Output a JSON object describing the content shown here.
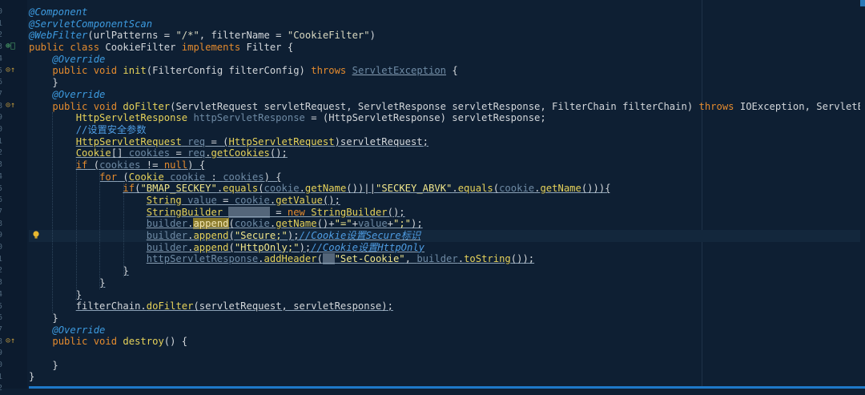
{
  "gutter": {
    "numbers": [
      "0",
      "1",
      "2",
      "3",
      "4",
      "5",
      "6",
      "7",
      "8",
      "9",
      "0",
      "1",
      "2",
      "3",
      "4",
      "5",
      "6",
      "7",
      "8",
      "9",
      "0",
      "1",
      "2",
      "3",
      "4",
      "5",
      "6",
      "7",
      "8",
      "9",
      "0",
      "1",
      "2"
    ],
    "marks": [
      {
        "row": 3,
        "icon": "class-marker-icon",
        "glyph": "⊕ͦ",
        "color": "green"
      },
      {
        "row": 5,
        "icon": "override-method-icon",
        "glyph": "⊙↑"
      },
      {
        "row": 8,
        "icon": "override-method-icon",
        "glyph": "⊙↑"
      },
      {
        "row": 28,
        "icon": "override-method-icon",
        "glyph": "⊙↑"
      }
    ]
  },
  "lines": [
    [
      [
        "ann",
        "@Component"
      ]
    ],
    [
      [
        "ann",
        "@ServletComponentScan"
      ]
    ],
    [
      [
        "ann",
        "@WebFilter"
      ],
      [
        "plain",
        "(urlPatterns = "
      ],
      [
        "str",
        "\"/*\""
      ],
      [
        "plain",
        ", filterName = "
      ],
      [
        "str",
        "\"CookieFilter\""
      ],
      [
        "plain",
        ")"
      ]
    ],
    [
      [
        "kw",
        "public class "
      ],
      [
        "plain",
        "CookieFilter "
      ],
      [
        "kw",
        "implements "
      ],
      [
        "plain",
        "Filter {"
      ]
    ],
    [
      [
        "plain",
        "    "
      ],
      [
        "ann",
        "@Override"
      ]
    ],
    [
      [
        "plain",
        "    "
      ],
      [
        "kw",
        "public void "
      ],
      [
        "method",
        "init"
      ],
      [
        "plain",
        "(FilterConfig filterConfig) "
      ],
      [
        "kw",
        "throws "
      ],
      [
        "muted ul",
        "ServletException"
      ],
      [
        "plain",
        " {"
      ]
    ],
    [
      [
        "plain",
        "    }"
      ]
    ],
    [
      [
        "plain",
        "    "
      ],
      [
        "ann",
        "@Override"
      ]
    ],
    [
      [
        "plain",
        "    "
      ],
      [
        "kw",
        "public void "
      ],
      [
        "method",
        "doFilter"
      ],
      [
        "plain",
        "(ServletRequest servletRequest, ServletResponse servletResponse, FilterChain filterChain) "
      ],
      [
        "kw",
        "throws "
      ],
      [
        "plain",
        "IOException, ServletExceptio"
      ]
    ],
    [
      [
        "plain",
        "        "
      ],
      [
        "cls",
        "HttpServletResponse "
      ],
      [
        "muted",
        "httpServletResponse"
      ],
      [
        "plain",
        " = (HttpServletResponse) servletResponse;"
      ]
    ],
    [
      [
        "plain",
        "        "
      ],
      [
        "cmtz",
        "//设置安全参数"
      ]
    ],
    [
      [
        "plain",
        "        "
      ],
      [
        "cls ul",
        "HttpServletRequest"
      ],
      [
        "plain ul",
        " "
      ],
      [
        "muted ul",
        "req"
      ],
      [
        "plain ul",
        " = ("
      ],
      [
        "cls ul",
        "HttpServletRequest"
      ],
      [
        "plain ul",
        ")servletRequest;"
      ]
    ],
    [
      [
        "plain",
        "        "
      ],
      [
        "cls ul",
        "Cookie"
      ],
      [
        "plain ul",
        "[] "
      ],
      [
        "muted ul",
        "cookies"
      ],
      [
        "plain ul",
        " = "
      ],
      [
        "muted ul",
        "req"
      ],
      [
        "plain ul",
        "."
      ],
      [
        "method ul",
        "getCookies"
      ],
      [
        "plain ul",
        "();"
      ]
    ],
    [
      [
        "plain",
        "        "
      ],
      [
        "kw ul",
        "if"
      ],
      [
        "plain ul",
        " ("
      ],
      [
        "muted ul",
        "cookies"
      ],
      [
        "plain ul",
        " != "
      ],
      [
        "kw ul",
        "null"
      ],
      [
        "plain ul",
        ") {"
      ]
    ],
    [
      [
        "plain",
        "            "
      ],
      [
        "kw ul",
        "for"
      ],
      [
        "plain ul",
        " ("
      ],
      [
        "cls ul",
        "Cookie"
      ],
      [
        "plain ul",
        " "
      ],
      [
        "muted ul",
        "cookie"
      ],
      [
        "plain ul",
        " : "
      ],
      [
        "muted ul",
        "cookies"
      ],
      [
        "plain ul",
        ") {"
      ]
    ],
    [
      [
        "plain",
        "                "
      ],
      [
        "kw ul",
        "if"
      ],
      [
        "plain ul",
        "("
      ],
      [
        "str2 ul",
        "\"BMAP_SECKEY\""
      ],
      [
        "plain ul",
        "."
      ],
      [
        "method ul",
        "equals"
      ],
      [
        "plain ul",
        "("
      ],
      [
        "muted ul",
        "cookie"
      ],
      [
        "plain ul",
        "."
      ],
      [
        "method ul",
        "getName"
      ],
      [
        "plain ul",
        "())||"
      ],
      [
        "str2 ul",
        "\"SECKEY_ABVK\""
      ],
      [
        "plain ul",
        "."
      ],
      [
        "method ul",
        "equals"
      ],
      [
        "plain ul",
        "("
      ],
      [
        "muted ul",
        "cookie"
      ],
      [
        "plain ul",
        "."
      ],
      [
        "method ul",
        "getName"
      ],
      [
        "plain ul",
        "())){"
      ]
    ],
    [
      [
        "plain",
        "                    "
      ],
      [
        "cls ul",
        "String"
      ],
      [
        "plain ul",
        " "
      ],
      [
        "muted ul",
        "value"
      ],
      [
        "plain ul",
        " = "
      ],
      [
        "muted ul",
        "cookie"
      ],
      [
        "plain ul",
        "."
      ],
      [
        "method ul",
        "getValue"
      ],
      [
        "plain ul",
        "();"
      ]
    ],
    [
      [
        "plain",
        "                    "
      ],
      [
        "cls ul",
        "StringBuilder"
      ],
      [
        "plain ul",
        " "
      ],
      [
        "hlbox ul",
        "builder"
      ],
      [
        "plain ul",
        " = "
      ],
      [
        "kw ul",
        "new "
      ],
      [
        "cls ul",
        "StringBuilder"
      ],
      [
        "plain ul",
        "();"
      ]
    ],
    [
      [
        "plain",
        "                    "
      ],
      [
        "muted ul",
        "builder"
      ],
      [
        "plain ul",
        "."
      ],
      [
        "hl ul",
        "append"
      ],
      [
        "plain ul",
        "("
      ],
      [
        "muted ul",
        "cookie"
      ],
      [
        "plain ul",
        "."
      ],
      [
        "method ul",
        "getName"
      ],
      [
        "plain ul",
        "()+"
      ],
      [
        "str2 ul",
        "\"=\""
      ],
      [
        "plain ul",
        "+"
      ],
      [
        "muted ul",
        "value"
      ],
      [
        "plain ul",
        "+"
      ],
      [
        "str2 ul",
        "\";\""
      ],
      [
        "plain ul",
        ");"
      ]
    ],
    [
      [
        "plain",
        "                    "
      ],
      [
        "muted ul",
        "builder"
      ],
      [
        "plain ul",
        "."
      ],
      [
        "method ul",
        "append"
      ],
      [
        "plain ul",
        "("
      ],
      [
        "str2 ul",
        "\"Secure;\""
      ],
      [
        "plain ul",
        ");"
      ],
      [
        "cmt ul",
        "//Cookie设置Secure标识"
      ]
    ],
    [
      [
        "plain",
        "                    "
      ],
      [
        "muted ul",
        "builder"
      ],
      [
        "plain ul",
        "."
      ],
      [
        "method ul",
        "append"
      ],
      [
        "plain ul",
        "("
      ],
      [
        "str2 ul",
        "\"HttpOnly;\""
      ],
      [
        "plain ul",
        ");"
      ],
      [
        "cmt ul",
        "//Cookie设置HttpOnly"
      ]
    ],
    [
      [
        "plain",
        "                    "
      ],
      [
        "muted ul",
        "httpServletResponse"
      ],
      [
        "plain ul",
        "."
      ],
      [
        "method ul",
        "addHeader"
      ],
      [
        "plain ul",
        "("
      ],
      [
        "hlbox ul",
        "na"
      ],
      [
        "str2 ul",
        "\"Set-Cookie\""
      ],
      [
        "plain ul",
        ", "
      ],
      [
        "muted ul",
        "builder"
      ],
      [
        "plain ul",
        "."
      ],
      [
        "method ul",
        "toString"
      ],
      [
        "plain ul",
        "());"
      ]
    ],
    [
      [
        "plain",
        "                "
      ],
      [
        "plain ul",
        "}"
      ]
    ],
    [
      [
        "plain",
        "            "
      ],
      [
        "plain ul",
        "}"
      ]
    ],
    [
      [
        "plain",
        "        "
      ],
      [
        "plain ul",
        "}"
      ]
    ],
    [
      [
        "plain",
        "        "
      ],
      [
        "plain ul",
        "filterChain."
      ],
      [
        "method ul",
        "doFilter"
      ],
      [
        "plain ul",
        "(servletRequest, servletResponse);"
      ]
    ],
    [
      [
        "plain",
        "    }"
      ]
    ],
    [
      [
        "plain",
        "    "
      ],
      [
        "ann",
        "@Override"
      ]
    ],
    [
      [
        "plain",
        "    "
      ],
      [
        "kw",
        "public void "
      ],
      [
        "method",
        "destroy"
      ],
      [
        "plain",
        "() {"
      ]
    ],
    [
      [
        "plain",
        ""
      ]
    ],
    [
      [
        "plain",
        "    }"
      ]
    ],
    [
      [
        "plain",
        "}"
      ]
    ]
  ],
  "current_line": 19,
  "colors": {
    "background": "#0e1f33",
    "keyword": "#e38a2e",
    "annotation": "#3d9be0",
    "class": "#e6d25a",
    "comment": "#4f9de3",
    "accent": "#1e78c8"
  }
}
